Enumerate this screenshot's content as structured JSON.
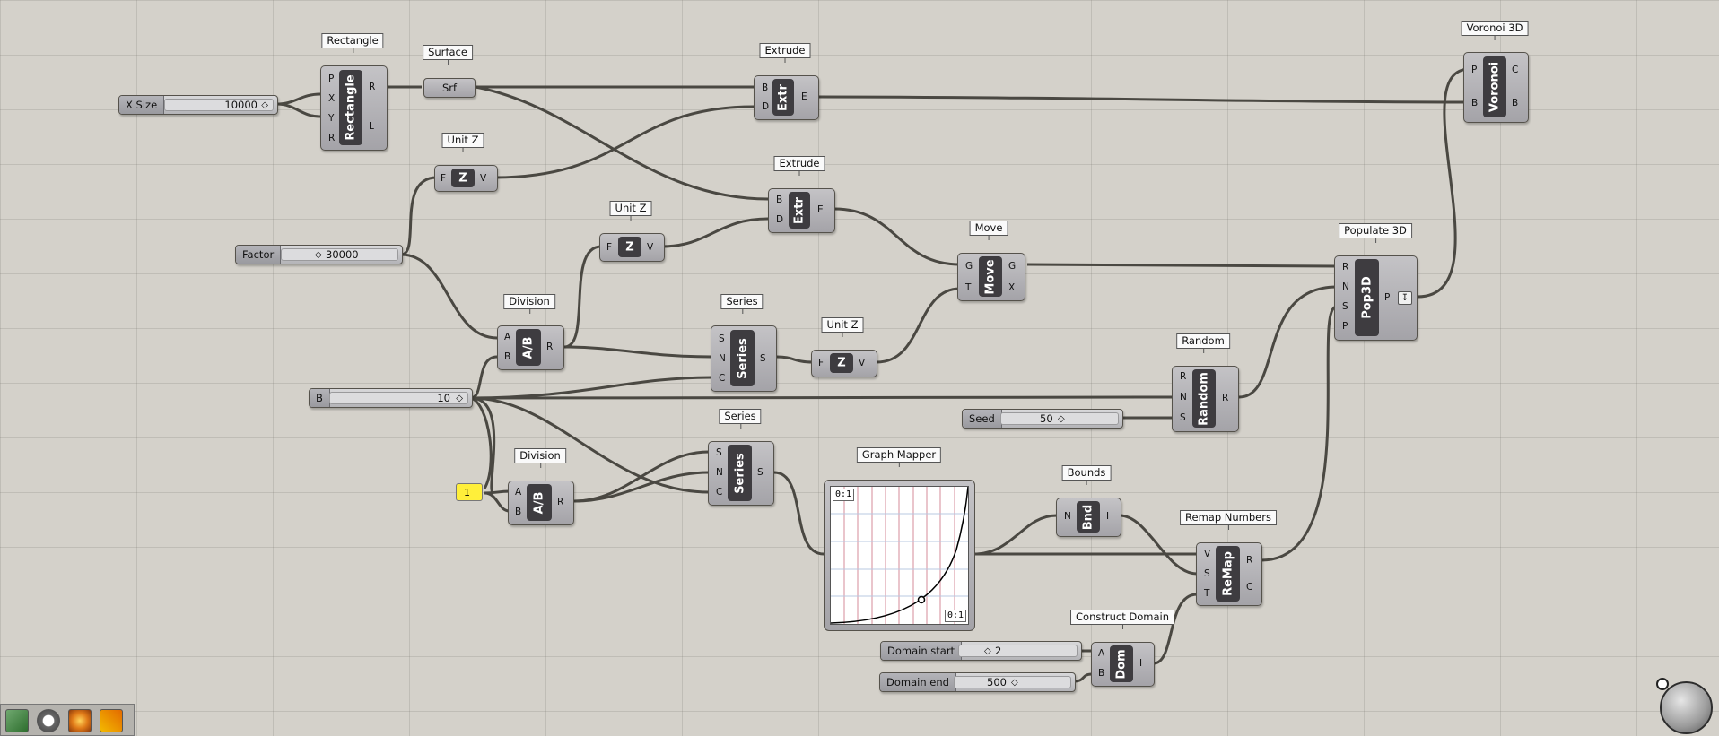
{
  "components": {
    "rectangle": {
      "tag": "Rectangle",
      "nick": "Rectangle",
      "inputs": [
        "P",
        "X",
        "Y",
        "R"
      ],
      "outputs": [
        "R",
        "L"
      ]
    },
    "surface": {
      "tag": "Surface",
      "nick": "Srf"
    },
    "extrude1": {
      "tag": "Extrude",
      "nick": "Extr",
      "inputs": [
        "B",
        "D"
      ],
      "outputs": [
        "E"
      ]
    },
    "extrude2": {
      "tag": "Extrude",
      "nick": "Extr",
      "inputs": [
        "B",
        "D"
      ],
      "outputs": [
        "E"
      ]
    },
    "unitz1": {
      "tag": "Unit Z",
      "nick": "Z",
      "inputs": [
        "F"
      ],
      "outputs": [
        "V"
      ]
    },
    "unitz2": {
      "tag": "Unit Z",
      "nick": "Z",
      "inputs": [
        "F"
      ],
      "outputs": [
        "V"
      ]
    },
    "unitz3": {
      "tag": "Unit Z",
      "nick": "Z",
      "inputs": [
        "F"
      ],
      "outputs": [
        "V"
      ]
    },
    "division1": {
      "tag": "Division",
      "nick": "A/B",
      "inputs": [
        "A",
        "B"
      ],
      "outputs": [
        "R"
      ]
    },
    "division2": {
      "tag": "Division",
      "nick": "A/B",
      "inputs": [
        "A",
        "B"
      ],
      "outputs": [
        "R"
      ]
    },
    "series1": {
      "tag": "Series",
      "nick": "Series",
      "inputs": [
        "S",
        "N",
        "C"
      ],
      "outputs": [
        "S"
      ]
    },
    "series2": {
      "tag": "Series",
      "nick": "Series",
      "inputs": [
        "S",
        "N",
        "C"
      ],
      "outputs": [
        "S"
      ]
    },
    "move": {
      "tag": "Move",
      "nick": "Move",
      "inputs": [
        "G",
        "T"
      ],
      "outputs": [
        "G",
        "X"
      ]
    },
    "populate3d": {
      "tag": "Populate 3D",
      "nick": "Pop3D",
      "inputs": [
        "R",
        "N",
        "S",
        "P"
      ],
      "outputs": [
        "P"
      ]
    },
    "voronoi3d": {
      "tag": "Voronoi 3D",
      "nick": "Voronoi",
      "inputs": [
        "P",
        "B"
      ],
      "outputs": [
        "C",
        "B"
      ]
    },
    "random": {
      "tag": "Random",
      "nick": "Random",
      "inputs": [
        "R",
        "N",
        "S"
      ],
      "outputs": [
        "R"
      ]
    },
    "graphmapper": {
      "tag": "Graph Mapper",
      "corner_tl": "0:1",
      "corner_br": "0:1"
    },
    "bounds": {
      "tag": "Bounds",
      "nick": "Bnd",
      "inputs": [
        "N"
      ],
      "outputs": [
        "I"
      ]
    },
    "remap": {
      "tag": "Remap Numbers",
      "nick": "ReMap",
      "inputs": [
        "V",
        "S",
        "T"
      ],
      "outputs": [
        "R",
        "C"
      ]
    },
    "constructdomain": {
      "tag": "Construct Domain",
      "nick": "Dom",
      "inputs": [
        "A",
        "B"
      ],
      "outputs": [
        "I"
      ]
    }
  },
  "sliders": {
    "xsize": {
      "label": "X Size",
      "value": "10000"
    },
    "factor": {
      "label": "Factor",
      "value": "30000"
    },
    "b": {
      "label": "B",
      "value": "10"
    },
    "seed": {
      "label": "Seed",
      "value": "50"
    },
    "domain_start": {
      "label": "Domain start",
      "value": "2"
    },
    "domain_end": {
      "label": "Domain end",
      "value": "500"
    }
  },
  "panel": {
    "value": "1"
  },
  "toolbar": {
    "icons": [
      "bake-icon",
      "preview-icon",
      "render-icon",
      "fire-icon"
    ]
  },
  "colors": {
    "canvas": "#d4d1ca",
    "component": "#b4b3b7",
    "panel": "#ffef3a",
    "wire": "#4a4842"
  }
}
